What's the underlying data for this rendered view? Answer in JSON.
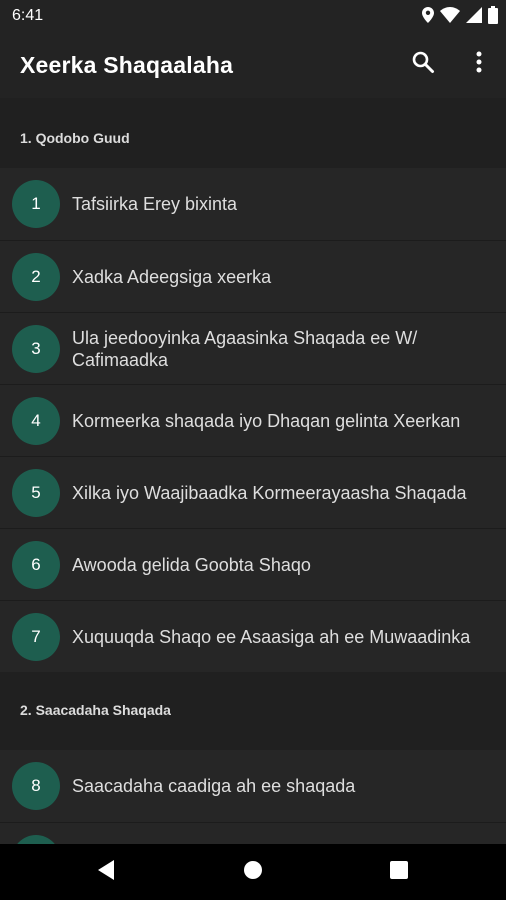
{
  "status": {
    "time": "6:41"
  },
  "app_bar": {
    "title": "Xeerka Shaqaalaha"
  },
  "sections": [
    {
      "title": "1. Qodobo Guud",
      "items": [
        {
          "number": "1",
          "label": "Tafsiirka Erey bixinta"
        },
        {
          "number": "2",
          "label": "Xadka Adeegsiga xeerka"
        },
        {
          "number": "3",
          "label": "Ula jeedooyinka Agaasinka Shaqada ee W/ Cafimaadka"
        },
        {
          "number": "4",
          "label": "Kormeerka shaqada iyo Dhaqan gelinta Xeerkan"
        },
        {
          "number": "5",
          "label": "Xilka iyo Waajibaadka Kormeerayaasha Shaqada"
        },
        {
          "number": "6",
          "label": "Awooda gelida Goobta Shaqo"
        },
        {
          "number": "7",
          "label": "Xuquuqda Shaqo ee Asaasiga ah ee Muwaadinka"
        }
      ]
    },
    {
      "title": "2. Saacadaha Shaqada",
      "items": [
        {
          "number": "8",
          "label": "Saacadaha caadiga ah ee shaqada"
        },
        {
          "number": "",
          "label": ""
        }
      ]
    }
  ],
  "icons": {
    "search": "search-icon",
    "overflow": "more-vert-icon",
    "nav_back": "back-triangle-icon",
    "nav_home": "home-circle-icon",
    "nav_recents": "recents-square-icon"
  },
  "colors": {
    "accent_circle": "#1e5e4f",
    "background": "#1c1c1c",
    "item_background": "#262626"
  }
}
